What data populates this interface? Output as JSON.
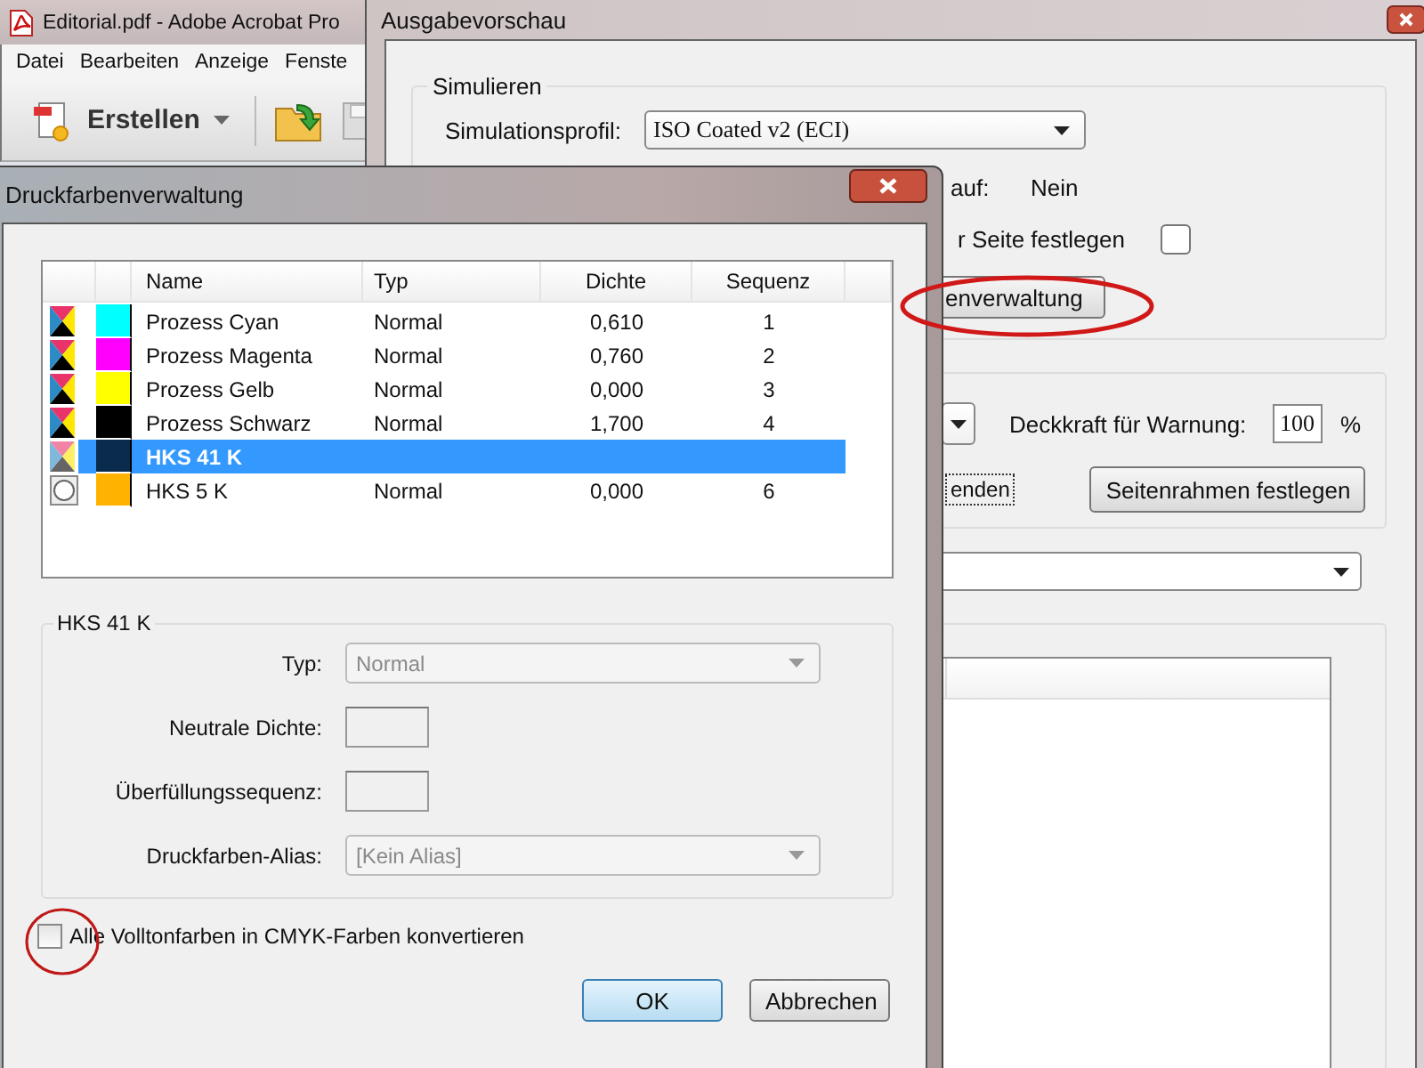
{
  "acrobat_window": {
    "title": "Editorial.pdf - Adobe Acrobat Pro",
    "menu": [
      "Datei",
      "Bearbeiten",
      "Anzeige",
      "Fenste"
    ],
    "create_button": "Erstellen"
  },
  "preview_window": {
    "title": "Ausgabevorschau",
    "simulate_group": {
      "legend": "Simulieren",
      "profile_label": "Simulationsprofil:",
      "profile_value": "ISO Coated v2 (ECI)",
      "row_2_label": "auf:",
      "row_2_value": "Nein",
      "row_3_label": "r Seite festlegen",
      "row_3_checked": false,
      "ink_button": "enverwaltung"
    },
    "warning_group": {
      "opacity_label": "Deckkraft für Warnung:",
      "opacity_value": "100",
      "percent": "%",
      "option_label": "enden",
      "frame_button": "Seitenrahmen festlegen"
    }
  },
  "ink_dialog": {
    "title": "Druckfarbenverwaltung",
    "columns": [
      "Name",
      "Typ",
      "Dichte",
      "Sequenz"
    ],
    "inks": [
      {
        "kind": "process",
        "color": "#00ffff",
        "name": "Prozess Cyan",
        "type": "Normal",
        "density": "0,610",
        "sequence": "1",
        "selected": false
      },
      {
        "kind": "process",
        "color": "#ff00ff",
        "name": "Prozess Magenta",
        "type": "Normal",
        "density": "0,760",
        "sequence": "2",
        "selected": false
      },
      {
        "kind": "process",
        "color": "#ffff00",
        "name": "Prozess Gelb",
        "type": "Normal",
        "density": "0,000",
        "sequence": "3",
        "selected": false
      },
      {
        "kind": "process",
        "color": "#000000",
        "name": "Prozess Schwarz",
        "type": "Normal",
        "density": "1,700",
        "sequence": "4",
        "selected": false
      },
      {
        "kind": "process",
        "color": "#0b2b4d",
        "name": "HKS 41 K",
        "selected": true
      },
      {
        "kind": "spot",
        "color": "#ffb300",
        "name": "HKS 5 K",
        "type": "Normal",
        "density": "0,000",
        "sequence": "6",
        "selected": false
      }
    ],
    "details": {
      "title": "HKS 41 K",
      "disabled": true,
      "type_label": "Typ:",
      "type_value": "Normal",
      "density_label": "Neutrale Dichte:",
      "trap_label": "Überfüllungssequenz:",
      "alias_label": "Druckfarben-Alias:",
      "alias_value": "[Kein Alias]"
    },
    "convert_all": {
      "label": "Alle Volltonfarben in CMYK-Farben konvertieren",
      "checked": false
    },
    "buttons": [
      {
        "label": "OK",
        "default": true
      },
      {
        "label": "Abbrechen",
        "default": false
      }
    ]
  }
}
